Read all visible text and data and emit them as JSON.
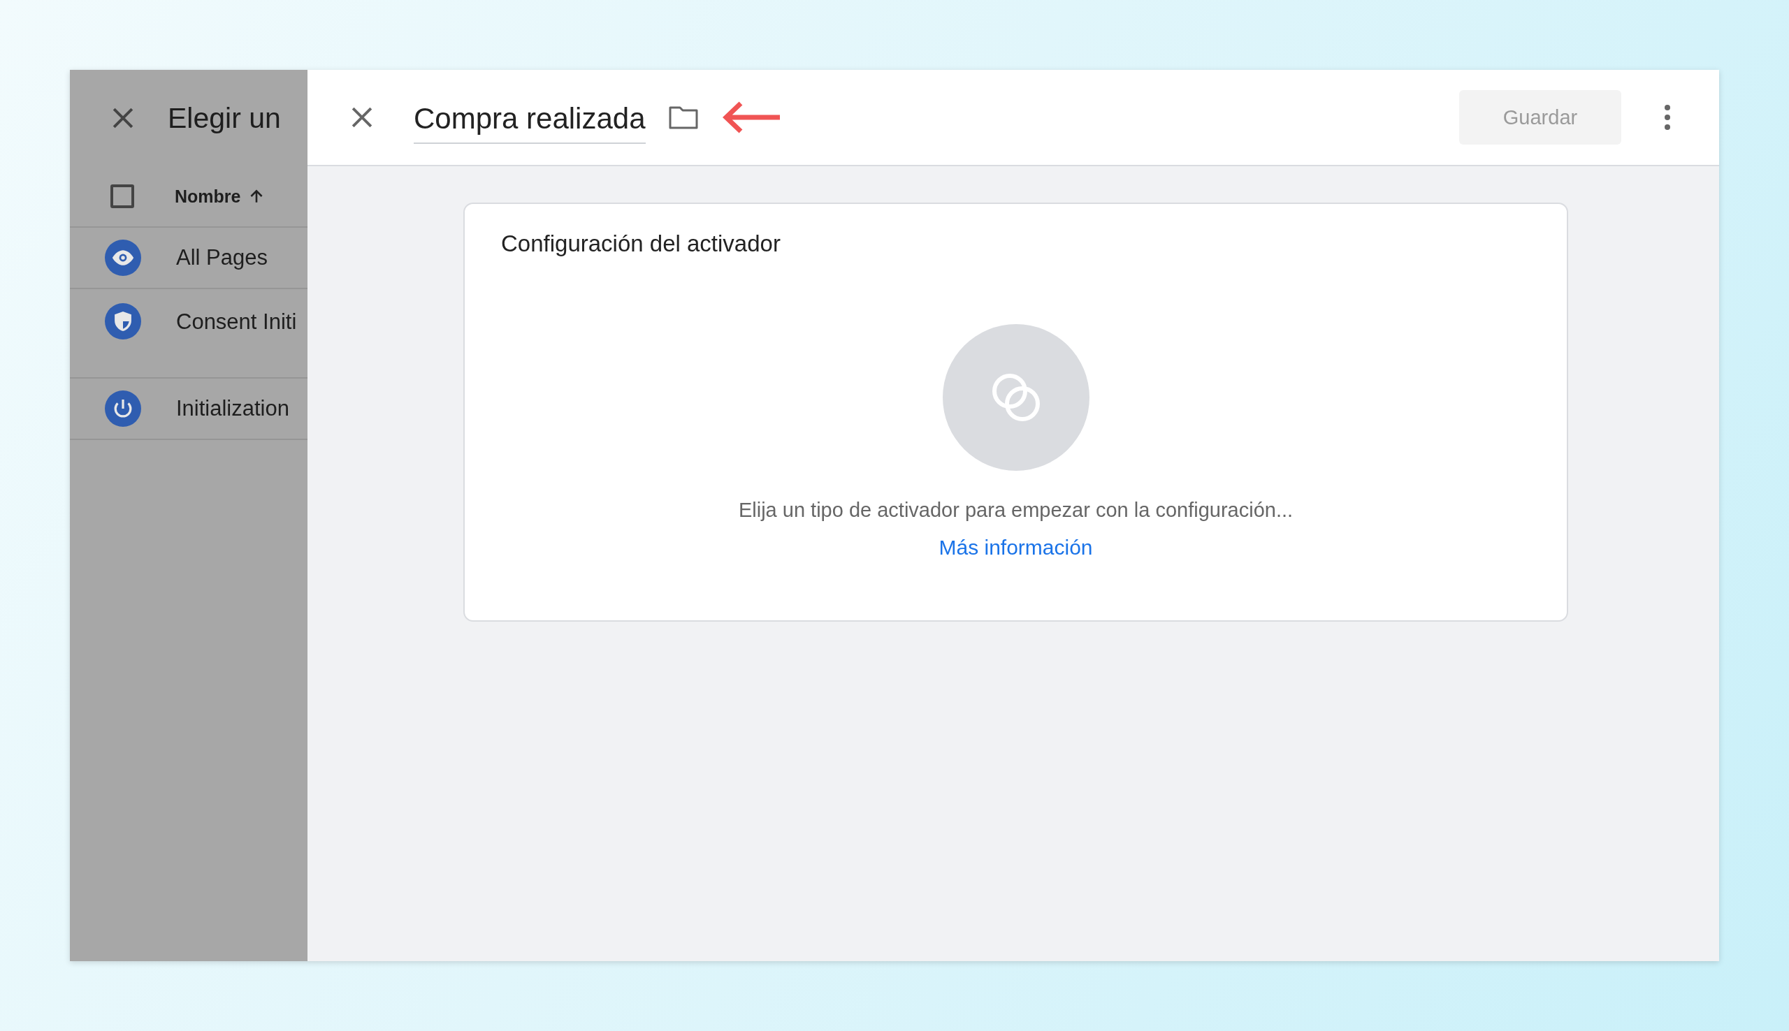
{
  "background_panel": {
    "title": "Elegir un",
    "column_header": "Nombre",
    "select_all_checked": false,
    "items": [
      {
        "kind": "eye",
        "label": "All Pages"
      },
      {
        "kind": "shield",
        "label": "Consent Initi"
      },
      {
        "kind": "power",
        "label": "Initialization"
      }
    ]
  },
  "editor": {
    "name": "Compra realizada",
    "save_button": {
      "label": "Guardar",
      "disabled": true
    },
    "card": {
      "title": "Configuración del activador",
      "hint": "Elija un tipo de activador para empezar con la configuración...",
      "link": "Más información"
    }
  }
}
